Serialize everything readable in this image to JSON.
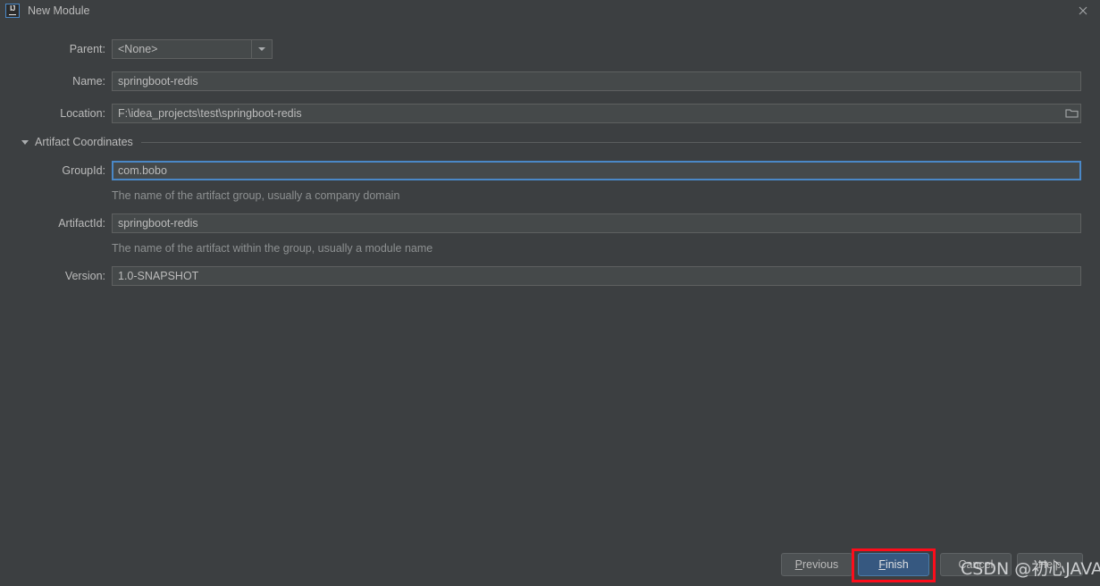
{
  "window": {
    "title": "New Module",
    "logo_icon": "intellij-idea-icon",
    "close_icon": "close-icon"
  },
  "form": {
    "parent": {
      "label": "Parent:",
      "value": "<None>",
      "dropdown_icon": "chevron-down-icon"
    },
    "name": {
      "label": "Name:",
      "value": "springboot-redis"
    },
    "location": {
      "label": "Location:",
      "value": "F:\\idea_projects\\test\\springboot-redis",
      "browse_icon": "folder-icon"
    }
  },
  "artifact_section": {
    "label": "Artifact Coordinates",
    "expanded": true,
    "collapse_icon": "triangle-down-icon",
    "group_id": {
      "label": "GroupId:",
      "value": "com.bobo",
      "hint": "The name of the artifact group, usually a company domain",
      "focused": true
    },
    "artifact_id": {
      "label": "ArtifactId:",
      "value": "springboot-redis",
      "hint": "The name of the artifact within the group, usually a module name"
    },
    "version": {
      "label": "Version:",
      "value": "1.0-SNAPSHOT"
    }
  },
  "footer": {
    "previous": {
      "label": "Previous",
      "mnemonic": "P",
      "rest": "revious"
    },
    "finish": {
      "label": "Finish",
      "mnemonic": "F",
      "rest": "inish",
      "primary": true
    },
    "cancel": {
      "label": "Cancel"
    },
    "help": {
      "label": "Help"
    }
  },
  "annotation": {
    "color": "#fc0d1b",
    "target": "finish-button"
  },
  "watermark": {
    "text": "CSDN @初心JAVA"
  },
  "colors": {
    "background": "#3c3f41",
    "field_background": "#45494a",
    "focus_border": "#4a88c7",
    "primary_button": "#365880",
    "text": "#bbbbbb",
    "hint_text": "#8d9091",
    "annotation": "#fc0d1b"
  }
}
